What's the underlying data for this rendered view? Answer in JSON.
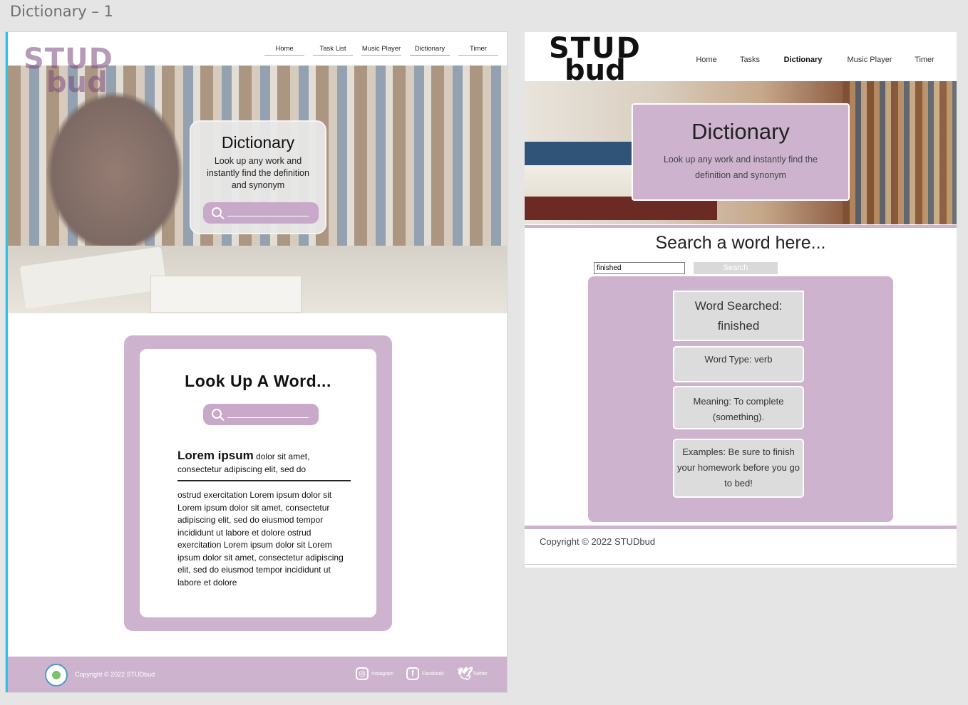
{
  "frame_title": "Dictionary – 1",
  "left": {
    "logo": {
      "line1": "STUD",
      "line2": "bud"
    },
    "nav": [
      {
        "label": "Home",
        "active": false
      },
      {
        "label": "Task List",
        "active": false
      },
      {
        "label": "Music Player",
        "active": false
      },
      {
        "label": "Dictionary",
        "active": true
      },
      {
        "label": "Timer",
        "active": false
      }
    ],
    "hero_card": {
      "title": "Dictionary",
      "text": "Look up any work and instantly find the definition and synonym"
    },
    "lookup": {
      "title": "Look Up A Word...",
      "lorem_bold": "Lorem ipsum",
      "lorem_rest": " dolor sit amet, consectetur adipiscing elit, sed do",
      "body": "ostrud exercitation Lorem ipsum dolor sit Lorem ipsum dolor sit amet, consectetur adipiscing elit, sed do eiusmod tempor incididunt ut labore et dolore ostrud exercitation Lorem ipsum dolor sit Lorem ipsum dolor sit amet, consectetur adipiscing elit, sed do eiusmod tempor incididunt ut labore et dolore"
    },
    "footer": {
      "copyright": "Copyright © 2022 STUDbud",
      "social": {
        "instagram": "Instagram",
        "facebook": "Facebook",
        "twitter": "Twitter"
      }
    }
  },
  "right": {
    "logo": {
      "line1": "STUD",
      "line2": "bud"
    },
    "nav": [
      {
        "label": "Home",
        "active": false
      },
      {
        "label": "Tasks",
        "active": false
      },
      {
        "label": "Dictionary",
        "active": true
      },
      {
        "label": "Music Player",
        "active": false
      },
      {
        "label": "Timer",
        "active": false
      }
    ],
    "hero_card": {
      "title": "Dictionary",
      "text": "Look up any work and instantly find the definition and synonym"
    },
    "search_title": "Search a word here...",
    "search_value": "finished",
    "search_button": "Search",
    "results": {
      "word_label": "Word Searched:",
      "word": "finished",
      "type_label": "Word Type:",
      "type": "verb",
      "meaning_label": "Meaning:",
      "meaning": "To complete (something).",
      "examples_label": "Examples:",
      "examples": "Be sure to finish your homework before you go to bed!"
    },
    "copyright": "Copyright © 2022 STUDbud"
  },
  "colors": {
    "accent": "#ceb3cf",
    "selection": "#2bc3e8"
  }
}
